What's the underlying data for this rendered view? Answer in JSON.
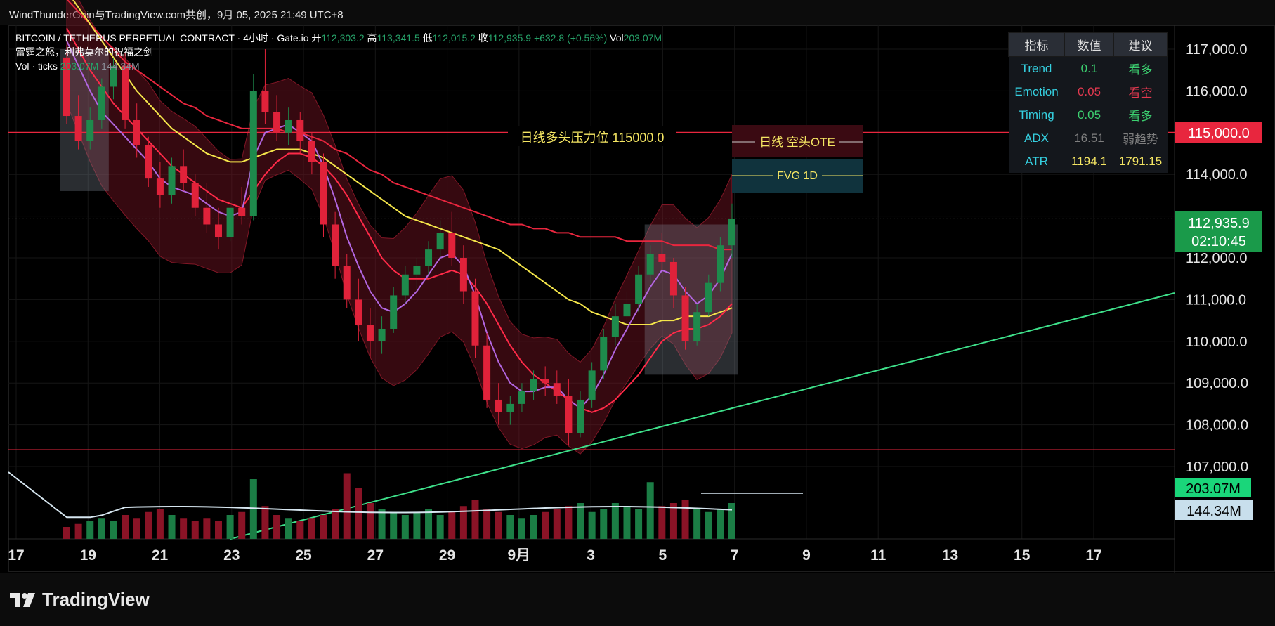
{
  "header": {
    "caption": "WindThunderGain与TradingView.com共创，9月 05, 2025 21:49 UTC+8"
  },
  "legend": {
    "symbol": "BITCOIN / TETHERUS PERPETUAL CONTRACT · 4小时 · Gate.io",
    "open_label": "开",
    "open": "112,303.2",
    "high_label": "高",
    "high": "113,341.5",
    "low_label": "低",
    "low": "112,015.2",
    "close_label": "收",
    "close": "112,935.9",
    "change": "+632.8 (+0.56%)",
    "vol_label": "Vol",
    "vol": "203.07M",
    "indicator_name": "雷霆之怒，利弗莫尔的祝福之剑",
    "vol_ticks_label": "Vol · ticks",
    "vol_ticks_1": "203.07M",
    "vol_ticks_2": "144.34M"
  },
  "annotations": {
    "resistance_label": "日线多头压力位 115000.0",
    "ote_label": "日线 空头OTE",
    "fvg_label": "FVG 1D"
  },
  "indicator_table": {
    "headers": [
      "指标",
      "数值",
      "建议"
    ],
    "rows": [
      {
        "name": "Trend",
        "value": "0.1",
        "advice": "看多",
        "value_color": "#3cd070",
        "advice_color": "#3cd070"
      },
      {
        "name": "Emotion",
        "value": "0.05",
        "advice": "看空",
        "value_color": "#e53950",
        "advice_color": "#e53950"
      },
      {
        "name": "Timing",
        "value": "0.05",
        "advice": "看多",
        "value_color": "#3cd070",
        "advice_color": "#3cd070"
      },
      {
        "name": "ADX",
        "value": "16.51",
        "advice": "弱趋势",
        "value_color": "#7f7f7f",
        "advice_color": "#7f7f7f"
      },
      {
        "name": "ATR",
        "value": "1194.1",
        "advice": "1791.15",
        "value_color": "#f5e663",
        "advice_color": "#f5e663"
      }
    ],
    "name_color": "#35d0e0"
  },
  "price_axis": {
    "labels": [
      "117,000.0",
      "116,000.0",
      "115,000.0",
      "114,000.0",
      "112,000.0",
      "111,000.0",
      "110,000.0",
      "109,000.0",
      "108,000.0",
      "107,000.0"
    ],
    "tag_resistance": "115,000.0",
    "tag_last_price": "112,935.9",
    "tag_countdown": "02:10:45",
    "tag_vol_1": "203.07M",
    "tag_vol_2": "144.34M"
  },
  "chart_data": {
    "type": "candlestick",
    "title": "",
    "x_ticks": [
      "17",
      "19",
      "21",
      "23",
      "25",
      "27",
      "29",
      "9月",
      "3",
      "5",
      "7",
      "9",
      "11",
      "13",
      "15",
      "17"
    ],
    "ylim": [
      106000,
      117800
    ],
    "resistance": 115000,
    "support": 107400,
    "last_price": 112935.9,
    "candles_ohlc": [
      [
        116800,
        117100,
        115200,
        115400
      ],
      [
        115400,
        115900,
        114600,
        114800
      ],
      [
        114800,
        115600,
        114600,
        115300
      ],
      [
        115300,
        116300,
        115100,
        116100
      ],
      [
        116100,
        116800,
        115800,
        116600
      ],
      [
        116600,
        116900,
        115100,
        115300
      ],
      [
        115300,
        115700,
        114400,
        114700
      ],
      [
        114700,
        114900,
        113700,
        113900
      ],
      [
        113900,
        114300,
        113200,
        113500
      ],
      [
        113500,
        114400,
        113300,
        114200
      ],
      [
        114200,
        114600,
        113600,
        113800
      ],
      [
        113800,
        114000,
        113000,
        113200
      ],
      [
        113200,
        113800,
        112600,
        112800
      ],
      [
        112800,
        113200,
        112200,
        112500
      ],
      [
        112500,
        113400,
        112400,
        113200
      ],
      [
        113200,
        113700,
        112800,
        113000
      ],
      [
        113000,
        116400,
        112900,
        116000
      ],
      [
        116000,
        117000,
        115200,
        115500
      ],
      [
        115500,
        115900,
        114800,
        115000
      ],
      [
        115000,
        115600,
        114700,
        115300
      ],
      [
        115300,
        115500,
        114500,
        114800
      ],
      [
        114800,
        115000,
        114000,
        114300
      ],
      [
        114300,
        114500,
        112500,
        112800
      ],
      [
        112800,
        113100,
        111500,
        111800
      ],
      [
        111800,
        112100,
        110800,
        111000
      ],
      [
        111000,
        111500,
        110000,
        110400
      ],
      [
        110400,
        110800,
        109600,
        110000
      ],
      [
        110000,
        110600,
        109700,
        110300
      ],
      [
        110300,
        111300,
        110200,
        111100
      ],
      [
        111100,
        111800,
        110900,
        111600
      ],
      [
        111600,
        112000,
        111200,
        111800
      ],
      [
        111800,
        112400,
        111600,
        112200
      ],
      [
        112200,
        112900,
        112000,
        112600
      ],
      [
        112600,
        113100,
        111800,
        112000
      ],
      [
        112000,
        112300,
        110900,
        111200
      ],
      [
        111200,
        111500,
        109600,
        109900
      ],
      [
        109900,
        110200,
        108400,
        108600
      ],
      [
        108600,
        109000,
        108000,
        108300
      ],
      [
        108300,
        108700,
        108000,
        108500
      ],
      [
        108500,
        109000,
        108300,
        108800
      ],
      [
        108800,
        109300,
        108600,
        109100
      ],
      [
        109100,
        109400,
        108700,
        109000
      ],
      [
        109000,
        109300,
        108500,
        108700
      ],
      [
        108700,
        109100,
        107500,
        107800
      ],
      [
        107800,
        108800,
        107700,
        108600
      ],
      [
        108600,
        109500,
        108400,
        109300
      ],
      [
        109300,
        110300,
        109100,
        110100
      ],
      [
        110100,
        110900,
        109900,
        110600
      ],
      [
        110600,
        111200,
        110300,
        110900
      ],
      [
        110900,
        111800,
        110700,
        111600
      ],
      [
        111600,
        112300,
        111400,
        112100
      ],
      [
        112100,
        112600,
        111700,
        111900
      ],
      [
        111900,
        112000,
        110800,
        111100
      ],
      [
        111100,
        111300,
        109800,
        110000
      ],
      [
        110000,
        110900,
        109900,
        110700
      ],
      [
        110700,
        111600,
        110600,
        111400
      ],
      [
        111400,
        112500,
        111200,
        112300
      ],
      [
        112300,
        113300,
        112000,
        112936
      ]
    ],
    "volume_rel": [
      0.2,
      0.25,
      0.3,
      0.35,
      0.3,
      0.4,
      0.35,
      0.45,
      0.5,
      0.4,
      0.35,
      0.3,
      0.35,
      0.3,
      0.4,
      0.45,
      1.0,
      0.55,
      0.4,
      0.35,
      0.3,
      0.35,
      0.4,
      0.5,
      1.1,
      0.85,
      0.6,
      0.5,
      0.45,
      0.4,
      0.45,
      0.5,
      0.4,
      0.45,
      0.55,
      0.65,
      0.5,
      0.45,
      0.4,
      0.35,
      0.4,
      0.45,
      0.5,
      0.55,
      0.6,
      0.45,
      0.5,
      0.6,
      0.55,
      0.5,
      0.95,
      0.55,
      0.6,
      0.65,
      0.5,
      0.45,
      0.5,
      0.6
    ],
    "ma_fast": [
      117200,
      116600,
      116000,
      115500,
      115200,
      114900,
      114600,
      114300,
      113900,
      113700,
      113600,
      113500,
      113300,
      113100,
      113000,
      113100,
      114400,
      115000,
      115100,
      115200,
      115000,
      114800,
      114200,
      113400,
      112500,
      111800,
      111200,
      110800,
      110700,
      110900,
      111200,
      111600,
      112000,
      112100,
      111800,
      111100,
      110200,
      109500,
      109000,
      108800,
      108800,
      108900,
      108900,
      108600,
      108400,
      108700,
      109200,
      109800,
      110300,
      110800,
      111300,
      111700,
      111600,
      111200,
      110900,
      111100,
      111500,
      112100
    ],
    "ma_slow": [
      117500,
      117000,
      116500,
      116100,
      115700,
      115400,
      115100,
      114800,
      114500,
      114200,
      114000,
      113800,
      113600,
      113400,
      113300,
      113200,
      113600,
      114000,
      114300,
      114500,
      114500,
      114400,
      114200,
      113900,
      113500,
      113000,
      112500,
      112000,
      111700,
      111500,
      111500,
      111500,
      111600,
      111700,
      111600,
      111300,
      110900,
      110400,
      109900,
      109500,
      109200,
      109000,
      108800,
      108600,
      108400,
      108300,
      108400,
      108600,
      108900,
      109200,
      109600,
      110000,
      110200,
      110300,
      110300,
      110400,
      110600,
      110900
    ],
    "ma_yellow": [
      118400,
      118000,
      117600,
      117200,
      116800,
      116400,
      116000,
      115700,
      115400,
      115100,
      114900,
      114700,
      114500,
      114400,
      114300,
      114300,
      114400,
      114500,
      114600,
      114600,
      114600,
      114500,
      114400,
      114200,
      114000,
      113800,
      113600,
      113400,
      113200,
      113000,
      112900,
      112800,
      112700,
      112600,
      112500,
      112400,
      112300,
      112200,
      112000,
      111800,
      111600,
      111400,
      111200,
      111000,
      110900,
      110700,
      110600,
      110500,
      110400,
      110400,
      110400,
      110500,
      110500,
      110600,
      110600,
      110600,
      110700,
      110800
    ],
    "ma_red": [
      118200,
      117900,
      117600,
      117300,
      117000,
      116700,
      116500,
      116300,
      116100,
      115900,
      115700,
      115600,
      115400,
      115300,
      115200,
      115100,
      115100,
      115100,
      115100,
      115000,
      115000,
      114900,
      114800,
      114600,
      114500,
      114300,
      114100,
      114000,
      113800,
      113700,
      113600,
      113500,
      113400,
      113300,
      113200,
      113100,
      113000,
      112900,
      112800,
      112800,
      112700,
      112700,
      112600,
      112600,
      112500,
      112500,
      112500,
      112500,
      112400,
      112400,
      112400,
      112400,
      112300,
      112300,
      112300,
      112300,
      112200,
      112200
    ]
  }
}
